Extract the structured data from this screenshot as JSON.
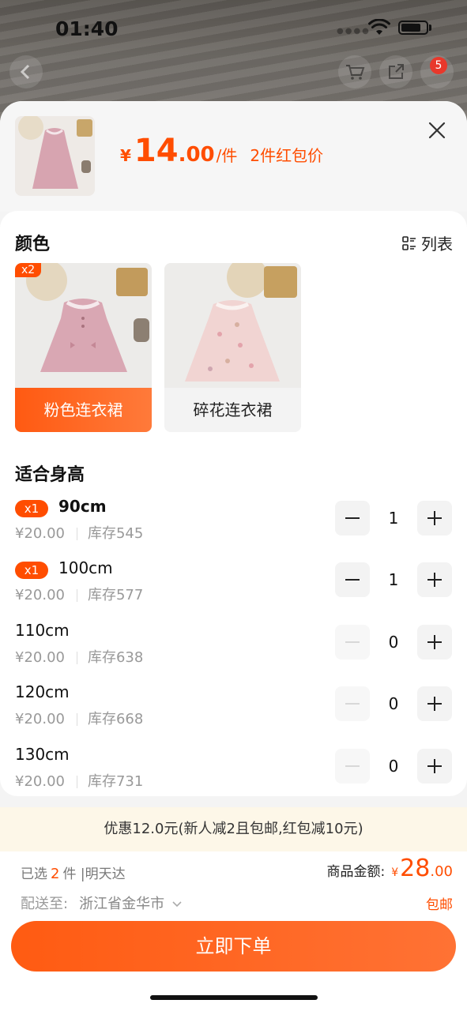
{
  "status_bar": {
    "time": "01:40",
    "notification_count": "5"
  },
  "header": {
    "price_currency": "¥",
    "price_int": "14",
    "price_dec": ".00",
    "price_unit": "/件",
    "price_note": "2件红包价"
  },
  "colors": {
    "title": "颜色",
    "list_toggle_label": "列表",
    "items": [
      {
        "label": "粉色连衣裙",
        "qty_tag": "x2",
        "selected": true
      },
      {
        "label": "碎花连衣裙",
        "selected": false
      }
    ]
  },
  "sizes": {
    "title": "适合身高",
    "rows": [
      {
        "name": "90cm",
        "tag": "x1",
        "price": "¥20.00",
        "stock": "库存545",
        "qty": "1"
      },
      {
        "name": "100cm",
        "tag": "x1",
        "price": "¥20.00",
        "stock": "库存577",
        "qty": "1"
      },
      {
        "name": "110cm",
        "price": "¥20.00",
        "stock": "库存638",
        "qty": "0"
      },
      {
        "name": "120cm",
        "price": "¥20.00",
        "stock": "库存668",
        "qty": "0"
      },
      {
        "name": "130cm",
        "price": "¥20.00",
        "stock": "库存731",
        "qty": "0"
      }
    ]
  },
  "promo": {
    "text": "优惠12.0元(新人减2且包邮,红包减10元)"
  },
  "summary": {
    "selected_prefix": "已选",
    "selected_count": "2",
    "selected_suffix": "件 |明天达",
    "amount_label": "商品金额:",
    "amount_currency": "¥",
    "amount_int": "28",
    "amount_dec": ".00",
    "ship_label": "配送至:",
    "ship_address": "浙江省金华市",
    "free_shipping": "包邮",
    "order_button": "立即下单"
  },
  "colors_theme": {
    "accent": "#ff4d00",
    "promo_bg": "#fdf7e8"
  }
}
